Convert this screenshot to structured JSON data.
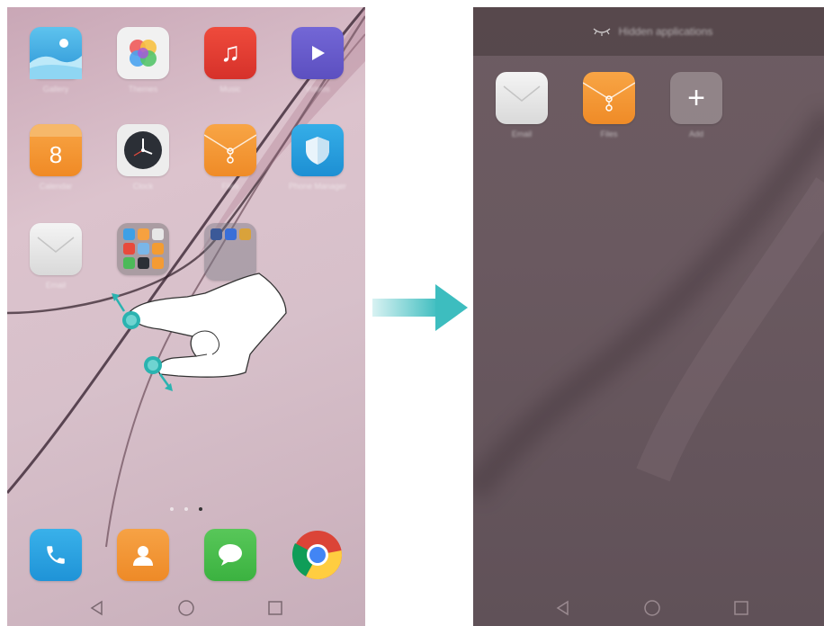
{
  "left_screen": {
    "apps_row1": [
      {
        "label": "Gallery",
        "icon": "gallery-icon"
      },
      {
        "label": "Themes",
        "icon": "themes-icon"
      },
      {
        "label": "Music",
        "icon": "music-icon"
      },
      {
        "label": "Videos",
        "icon": "videos-icon"
      }
    ],
    "apps_row2": [
      {
        "label": "Calendar",
        "icon": "calendar-icon",
        "glyph": "8"
      },
      {
        "label": "Clock",
        "icon": "clock-icon"
      },
      {
        "label": "Files",
        "icon": "files-icon"
      },
      {
        "label": "Phone Manager",
        "icon": "phone-manager-icon"
      }
    ],
    "apps_row3": [
      {
        "label": "Email",
        "icon": "email-icon"
      }
    ],
    "dock": [
      "phone-icon",
      "contacts-icon",
      "messages-icon",
      "chrome-icon"
    ],
    "page_indicator": {
      "count": 3,
      "active": 3
    }
  },
  "right_screen": {
    "header_title": "Hidden applications",
    "apps": [
      {
        "label": "Email",
        "icon": "email-icon"
      },
      {
        "label": "Files",
        "icon": "files-icon"
      },
      {
        "label": "Add",
        "icon": "add-icon",
        "glyph": "+"
      }
    ]
  },
  "colors": {
    "arrow": "#3dbdbf",
    "accent_gesture": "#2ab3b0"
  }
}
